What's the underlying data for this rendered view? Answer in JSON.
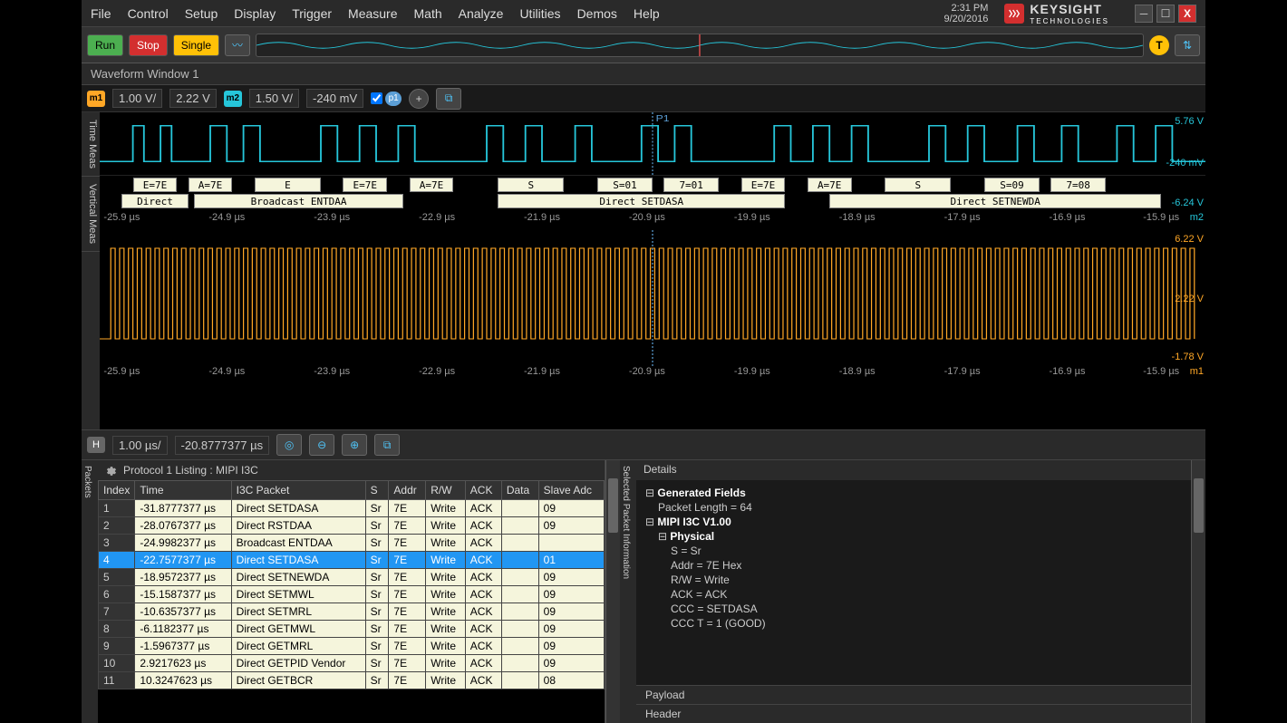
{
  "menu": {
    "items": [
      "File",
      "Control",
      "Setup",
      "Display",
      "Trigger",
      "Measure",
      "Math",
      "Analyze",
      "Utilities",
      "Demos",
      "Help"
    ]
  },
  "clock": {
    "time": "2:31 PM",
    "date": "9/20/2016"
  },
  "brand": {
    "name": "KEYSIGHT",
    "sub": "TECHNOLOGIES"
  },
  "controls": {
    "run": "Run",
    "stop": "Stop",
    "single": "Single",
    "trigger": "T"
  },
  "window_label": "Waveform Window 1",
  "channels": {
    "m1": {
      "scale": "1.00 V/",
      "offset": "2.22 V"
    },
    "m2": {
      "scale": "1.50 V/",
      "offset": "-240 mV"
    },
    "p1": "p1"
  },
  "voltage_labels": {
    "top_hi": "5.76 V",
    "top_mid": "-240 mV",
    "top_lo": "-6.24 V",
    "bot_hi": "6.22 V",
    "bot_mid": "2.22 V",
    "bot_lo": "-1.78 V"
  },
  "decode_top": [
    "E=7E",
    "A=7E",
    "E",
    "E=7E",
    "A=7E",
    "S",
    "S=01",
    "7=01",
    "E=7E",
    "A=7E",
    "S",
    "S=09",
    "7=08"
  ],
  "decode_bottom": [
    "Direct",
    "Broadcast ENTDAA",
    "Direct SETDASA",
    "Direct SETNEWDA"
  ],
  "time_axis": [
    "-25.9 µs",
    "-24.9 µs",
    "-23.9 µs",
    "-22.9 µs",
    "-21.9 µs",
    "-20.9 µs",
    "-19.9 µs",
    "-18.9 µs",
    "-17.9 µs",
    "-16.9 µs",
    "-15.9 µs"
  ],
  "axis_ch": {
    "top": "m2",
    "bot": "m1"
  },
  "horiz": {
    "scale": "1.00 µs/",
    "delay": "-20.8777377 µs"
  },
  "side_tabs": [
    "Time Meas",
    "Vertical Meas"
  ],
  "protocol_title": "Protocol 1 Listing : MIPI I3C",
  "packets_tab": "Packets",
  "details_tab": "Selected Packet Information",
  "table": {
    "headers": [
      "Index",
      "Time",
      "I3C Packet",
      "S",
      "Addr",
      "R/W",
      "ACK",
      "Data",
      "Slave Adc"
    ],
    "selected_index": 4,
    "rows": [
      {
        "idx": "1",
        "time": "-31.8777377 µs",
        "pkt": "Direct SETDASA",
        "s": "Sr",
        "addr": "7E",
        "rw": "Write",
        "ack": "ACK",
        "data": "",
        "sa": "09"
      },
      {
        "idx": "2",
        "time": "-28.0767377 µs",
        "pkt": "Direct RSTDAA",
        "s": "Sr",
        "addr": "7E",
        "rw": "Write",
        "ack": "ACK",
        "data": "",
        "sa": "09"
      },
      {
        "idx": "3",
        "time": "-24.9982377 µs",
        "pkt": "Broadcast ENTDAA",
        "s": "Sr",
        "addr": "7E",
        "rw": "Write",
        "ack": "ACK",
        "data": "",
        "sa": ""
      },
      {
        "idx": "4",
        "time": "-22.7577377 µs",
        "pkt": "Direct SETDASA",
        "s": "Sr",
        "addr": "7E",
        "rw": "Write",
        "ack": "ACK",
        "data": "",
        "sa": "01"
      },
      {
        "idx": "5",
        "time": "-18.9572377 µs",
        "pkt": "Direct SETNEWDA",
        "s": "Sr",
        "addr": "7E",
        "rw": "Write",
        "ack": "ACK",
        "data": "",
        "sa": "09"
      },
      {
        "idx": "6",
        "time": "-15.1587377 µs",
        "pkt": "Direct SETMWL",
        "s": "Sr",
        "addr": "7E",
        "rw": "Write",
        "ack": "ACK",
        "data": "",
        "sa": "09"
      },
      {
        "idx": "7",
        "time": "-10.6357377 µs",
        "pkt": "Direct SETMRL",
        "s": "Sr",
        "addr": "7E",
        "rw": "Write",
        "ack": "ACK",
        "data": "",
        "sa": "09"
      },
      {
        "idx": "8",
        "time": "-6.1182377 µs",
        "pkt": "Direct GETMWL",
        "s": "Sr",
        "addr": "7E",
        "rw": "Write",
        "ack": "ACK",
        "data": "",
        "sa": "09"
      },
      {
        "idx": "9",
        "time": "-1.5967377 µs",
        "pkt": "Direct GETMRL",
        "s": "Sr",
        "addr": "7E",
        "rw": "Write",
        "ack": "ACK",
        "data": "",
        "sa": "09"
      },
      {
        "idx": "10",
        "time": "2.9217623 µs",
        "pkt": "Direct GETPID Vendor",
        "s": "Sr",
        "addr": "7E",
        "rw": "Write",
        "ack": "ACK",
        "data": "",
        "sa": "09"
      },
      {
        "idx": "11",
        "time": "10.3247623 µs",
        "pkt": "Direct GETBCR",
        "s": "Sr",
        "addr": "7E",
        "rw": "Write",
        "ack": "ACK",
        "data": "",
        "sa": "08"
      }
    ]
  },
  "details": {
    "header": "Details",
    "gen_fields": "Generated Fields",
    "pkt_len": "Packet Length = 64",
    "proto": "MIPI I3C V1.00",
    "physical": "Physical",
    "s": "S = Sr",
    "addr": "Addr = 7E Hex",
    "rw": "R/W = Write",
    "ack": "ACK = ACK",
    "ccc": "CCC = SETDASA",
    "ccct": "CCC T = 1 (GOOD)",
    "payload": "Payload",
    "header_foot": "Header"
  }
}
